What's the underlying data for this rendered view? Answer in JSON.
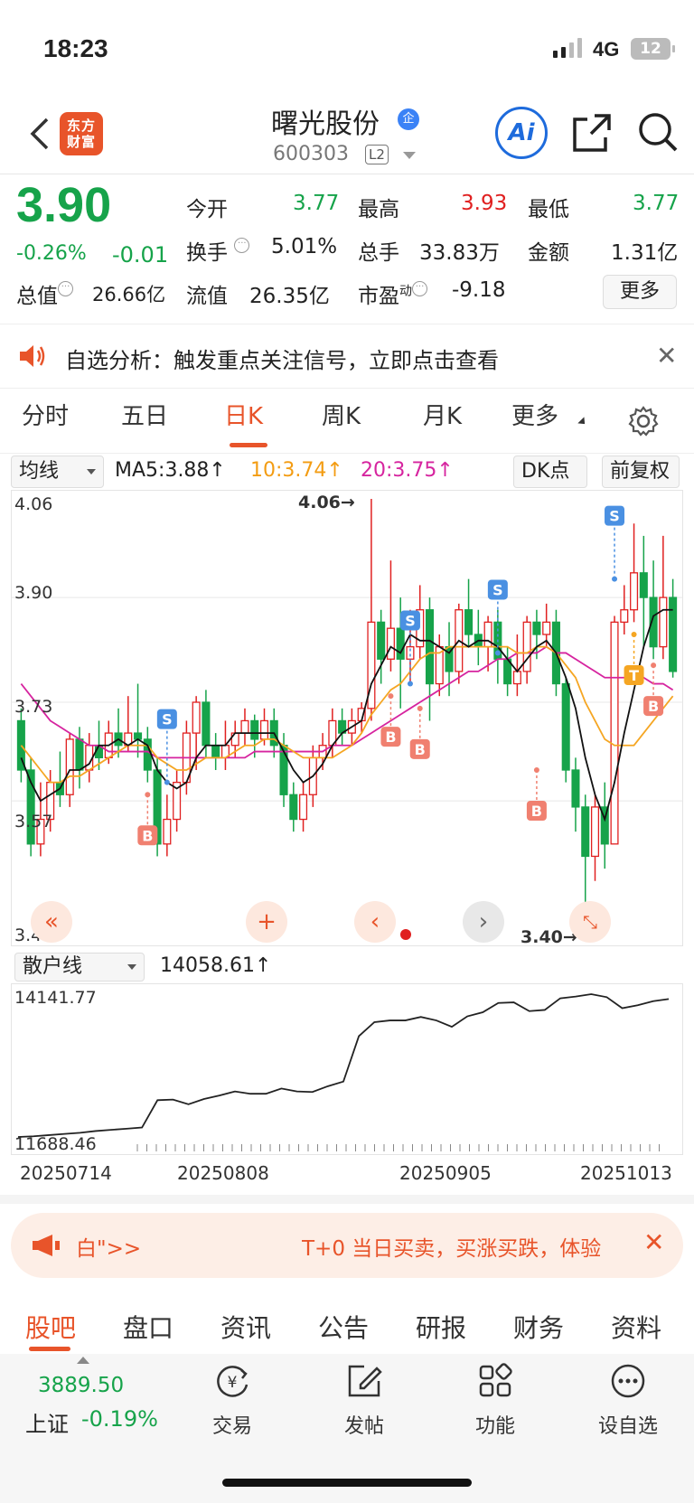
{
  "status": {
    "time": "18:23",
    "network": "4G",
    "battery": "12"
  },
  "header": {
    "brand": "东方财富",
    "title": "曙光股份",
    "badge": "企",
    "code": "600303",
    "level": "L2",
    "ai": "Ai"
  },
  "quote": {
    "price": "3.90",
    "change_pct": "-0.26%",
    "change": "-0.01",
    "fields": [
      {
        "label": "今开",
        "value": "3.77",
        "color": "#16a34a"
      },
      {
        "label": "最高",
        "value": "3.93",
        "color": "#e02020"
      },
      {
        "label": "最低",
        "value": "3.77",
        "color": "#16a34a"
      },
      {
        "label": "换手",
        "value": "5.01%",
        "color": "#222222"
      },
      {
        "label": "总手",
        "value": "33.83万",
        "color": "#222222"
      },
      {
        "label": "金额",
        "value": "1.31亿",
        "color": "#222222"
      },
      {
        "label": "总值",
        "value": "26.66亿",
        "color": "#222222"
      },
      {
        "label": "流值",
        "value": "26.35亿",
        "color": "#222222"
      },
      {
        "label": "市盈",
        "value": "-9.18",
        "color": "#222222"
      }
    ],
    "pe_sup": "动",
    "more": "更多"
  },
  "notice": {
    "text": "自选分析：触发重点关注信号，立即点击查看"
  },
  "chart_tabs": [
    "分时",
    "五日",
    "日K",
    "周K",
    "月K",
    "更多"
  ],
  "active_tab": "日K",
  "indicator": {
    "select": "均线",
    "ma5": "MA5:3.88↑",
    "ma10": "10:3.74↑",
    "ma20": "20:3.75↑",
    "dk": "DK点",
    "adjust": "前复权"
  },
  "chart_data": {
    "type": "candlestick",
    "y_ticks": [
      "4.06",
      "3.90",
      "3.73",
      "3.57",
      "3.40"
    ],
    "ylim": [
      3.4,
      4.06
    ],
    "high_label": "4.06→",
    "low_label": "3.40→",
    "candles": [
      [
        3.7,
        3.62,
        3.72,
        3.6
      ],
      [
        3.62,
        3.5,
        3.64,
        3.48
      ],
      [
        3.5,
        3.54,
        3.6,
        3.48
      ],
      [
        3.54,
        3.6,
        3.62,
        3.52
      ],
      [
        3.6,
        3.58,
        3.65,
        3.56
      ],
      [
        3.58,
        3.67,
        3.68,
        3.56
      ],
      [
        3.67,
        3.62,
        3.69,
        3.59
      ],
      [
        3.62,
        3.66,
        3.68,
        3.6
      ],
      [
        3.66,
        3.64,
        3.7,
        3.62
      ],
      [
        3.64,
        3.68,
        3.7,
        3.63
      ],
      [
        3.68,
        3.66,
        3.72,
        3.64
      ],
      [
        3.66,
        3.68,
        3.74,
        3.65
      ],
      [
        3.68,
        3.67,
        3.76,
        3.64
      ],
      [
        3.67,
        3.62,
        3.69,
        3.6
      ],
      [
        3.62,
        3.5,
        3.64,
        3.48
      ],
      [
        3.5,
        3.54,
        3.58,
        3.48
      ],
      [
        3.54,
        3.6,
        3.62,
        3.52
      ],
      [
        3.6,
        3.68,
        3.7,
        3.58
      ],
      [
        3.68,
        3.73,
        3.74,
        3.62
      ],
      [
        3.73,
        3.66,
        3.75,
        3.64
      ],
      [
        3.66,
        3.64,
        3.68,
        3.62
      ],
      [
        3.64,
        3.66,
        3.7,
        3.62
      ],
      [
        3.66,
        3.68,
        3.7,
        3.64
      ],
      [
        3.68,
        3.7,
        3.72,
        3.66
      ],
      [
        3.7,
        3.67,
        3.71,
        3.64
      ],
      [
        3.67,
        3.7,
        3.72,
        3.66
      ],
      [
        3.7,
        3.66,
        3.72,
        3.64
      ],
      [
        3.66,
        3.58,
        3.68,
        3.56
      ],
      [
        3.58,
        3.54,
        3.6,
        3.52
      ],
      [
        3.54,
        3.58,
        3.6,
        3.52
      ],
      [
        3.58,
        3.64,
        3.66,
        3.56
      ],
      [
        3.64,
        3.66,
        3.68,
        3.62
      ],
      [
        3.66,
        3.7,
        3.72,
        3.64
      ],
      [
        3.7,
        3.68,
        3.72,
        3.66
      ],
      [
        3.68,
        3.7,
        3.72,
        3.66
      ],
      [
        3.7,
        3.72,
        3.73,
        3.68
      ],
      [
        3.72,
        3.86,
        4.06,
        3.7
      ],
      [
        3.86,
        3.8,
        3.88,
        3.76
      ],
      [
        3.8,
        3.85,
        3.96,
        3.78
      ],
      [
        3.85,
        3.8,
        3.9,
        3.72
      ],
      [
        3.8,
        3.82,
        3.88,
        3.76
      ],
      [
        3.82,
        3.88,
        3.92,
        3.8
      ],
      [
        3.88,
        3.76,
        3.9,
        3.7
      ],
      [
        3.76,
        3.82,
        3.84,
        3.74
      ],
      [
        3.82,
        3.78,
        3.86,
        3.74
      ],
      [
        3.78,
        3.88,
        3.89,
        3.76
      ],
      [
        3.88,
        3.84,
        3.93,
        3.82
      ],
      [
        3.84,
        3.82,
        3.88,
        3.79
      ],
      [
        3.82,
        3.86,
        3.87,
        3.78
      ],
      [
        3.86,
        3.8,
        3.88,
        3.76
      ],
      [
        3.8,
        3.76,
        3.82,
        3.74
      ],
      [
        3.76,
        3.78,
        3.84,
        3.74
      ],
      [
        3.78,
        3.86,
        3.87,
        3.76
      ],
      [
        3.86,
        3.84,
        3.88,
        3.8
      ],
      [
        3.84,
        3.86,
        3.89,
        3.82
      ],
      [
        3.86,
        3.76,
        3.88,
        3.74
      ],
      [
        3.76,
        3.62,
        3.77,
        3.6
      ],
      [
        3.62,
        3.56,
        3.64,
        3.52
      ],
      [
        3.56,
        3.48,
        3.58,
        3.4
      ],
      [
        3.48,
        3.56,
        3.58,
        3.44
      ],
      [
        3.56,
        3.5,
        3.6,
        3.46
      ],
      [
        3.5,
        3.86,
        3.87,
        3.5
      ],
      [
        3.86,
        3.88,
        3.92,
        3.84
      ],
      [
        3.88,
        3.94,
        4.02,
        3.86
      ],
      [
        3.94,
        3.9,
        4.0,
        3.82
      ],
      [
        3.9,
        3.82,
        3.96,
        3.8
      ],
      [
        3.82,
        3.9,
        4.0,
        3.8
      ],
      [
        3.9,
        3.78,
        3.93,
        3.77
      ]
    ],
    "ma5": [
      3.64,
      3.6,
      3.57,
      3.58,
      3.59,
      3.62,
      3.62,
      3.63,
      3.66,
      3.66,
      3.67,
      3.66,
      3.67,
      3.66,
      3.62,
      3.6,
      3.59,
      3.6,
      3.64,
      3.66,
      3.66,
      3.66,
      3.68,
      3.68,
      3.68,
      3.68,
      3.68,
      3.65,
      3.62,
      3.6,
      3.61,
      3.63,
      3.66,
      3.68,
      3.69,
      3.7,
      3.76,
      3.79,
      3.82,
      3.81,
      3.84,
      3.83,
      3.83,
      3.82,
      3.81,
      3.83,
      3.82,
      3.83,
      3.83,
      3.82,
      3.8,
      3.78,
      3.8,
      3.82,
      3.83,
      3.81,
      3.77,
      3.72,
      3.64,
      3.58,
      3.54,
      3.6,
      3.68,
      3.75,
      3.82,
      3.87,
      3.88,
      3.88
    ],
    "ma10": [
      3.66,
      3.64,
      3.62,
      3.6,
      3.6,
      3.61,
      3.61,
      3.62,
      3.63,
      3.64,
      3.65,
      3.66,
      3.66,
      3.66,
      3.64,
      3.63,
      3.62,
      3.62,
      3.63,
      3.64,
      3.64,
      3.64,
      3.65,
      3.66,
      3.66,
      3.67,
      3.67,
      3.66,
      3.65,
      3.64,
      3.64,
      3.64,
      3.64,
      3.65,
      3.66,
      3.68,
      3.71,
      3.73,
      3.75,
      3.76,
      3.78,
      3.8,
      3.81,
      3.81,
      3.82,
      3.82,
      3.82,
      3.82,
      3.82,
      3.82,
      3.82,
      3.81,
      3.81,
      3.82,
      3.82,
      3.81,
      3.79,
      3.77,
      3.73,
      3.7,
      3.67,
      3.66,
      3.66,
      3.66,
      3.68,
      3.7,
      3.72,
      3.74
    ],
    "ma20": [
      3.76,
      3.74,
      3.72,
      3.7,
      3.69,
      3.68,
      3.67,
      3.66,
      3.66,
      3.65,
      3.65,
      3.65,
      3.65,
      3.65,
      3.64,
      3.64,
      3.64,
      3.64,
      3.64,
      3.64,
      3.64,
      3.64,
      3.64,
      3.64,
      3.65,
      3.65,
      3.65,
      3.65,
      3.65,
      3.65,
      3.65,
      3.65,
      3.66,
      3.66,
      3.66,
      3.67,
      3.68,
      3.69,
      3.7,
      3.71,
      3.72,
      3.73,
      3.74,
      3.75,
      3.76,
      3.77,
      3.78,
      3.78,
      3.79,
      3.8,
      3.8,
      3.81,
      3.81,
      3.81,
      3.82,
      3.81,
      3.81,
      3.8,
      3.79,
      3.78,
      3.77,
      3.77,
      3.77,
      3.77,
      3.77,
      3.76,
      3.76,
      3.75
    ],
    "signals": [
      {
        "type": "S",
        "index": 15,
        "price": 3.6
      },
      {
        "type": "B",
        "index": 13,
        "price": 3.58
      },
      {
        "type": "B",
        "index": 38,
        "price": 3.74
      },
      {
        "type": "S",
        "index": 40,
        "price": 3.76
      },
      {
        "type": "B",
        "index": 41,
        "price": 3.72
      },
      {
        "type": "S",
        "index": 49,
        "price": 3.81
      },
      {
        "type": "B",
        "index": 53,
        "price": 3.62
      },
      {
        "type": "S",
        "index": 61,
        "price": 3.93
      },
      {
        "type": "T",
        "index": 63,
        "price": 3.84
      },
      {
        "type": "B",
        "index": 65,
        "price": 3.79
      }
    ]
  },
  "sub_chart": {
    "select": "散户线",
    "value": "14058.61↑",
    "max": "14141.77",
    "min": "11688.46",
    "values": [
      11688,
      11700,
      11720,
      11740,
      11760,
      11790,
      11810,
      11830,
      11850,
      12320,
      12330,
      12250,
      12340,
      12400,
      12470,
      12430,
      12430,
      12520,
      12470,
      12460,
      12560,
      12640,
      13420,
      13660,
      13690,
      13690,
      13750,
      13690,
      13580,
      13760,
      13830,
      13990,
      14000,
      13850,
      13870,
      14070,
      14100,
      14141,
      14090,
      13900,
      13950,
      14020,
      14058
    ],
    "dates": [
      "20250714",
      "20250808",
      "20250905",
      "20251013"
    ]
  },
  "promo": {
    "left": "白\">>",
    "text": "T+0 当日买卖，买涨买跌，体验"
  },
  "bottom_tabs": [
    "股吧",
    "盘口",
    "资讯",
    "公告",
    "研报",
    "财务",
    "资料"
  ],
  "index": {
    "value": "3889.50",
    "name": "上证",
    "change": "-0.19%"
  },
  "nav": [
    {
      "label": "交易",
      "icon": "yuan-swap-icon"
    },
    {
      "label": "发帖",
      "icon": "edit-icon"
    },
    {
      "label": "功能",
      "icon": "grid-icon"
    },
    {
      "label": "设自选",
      "icon": "more-dots-icon"
    }
  ]
}
